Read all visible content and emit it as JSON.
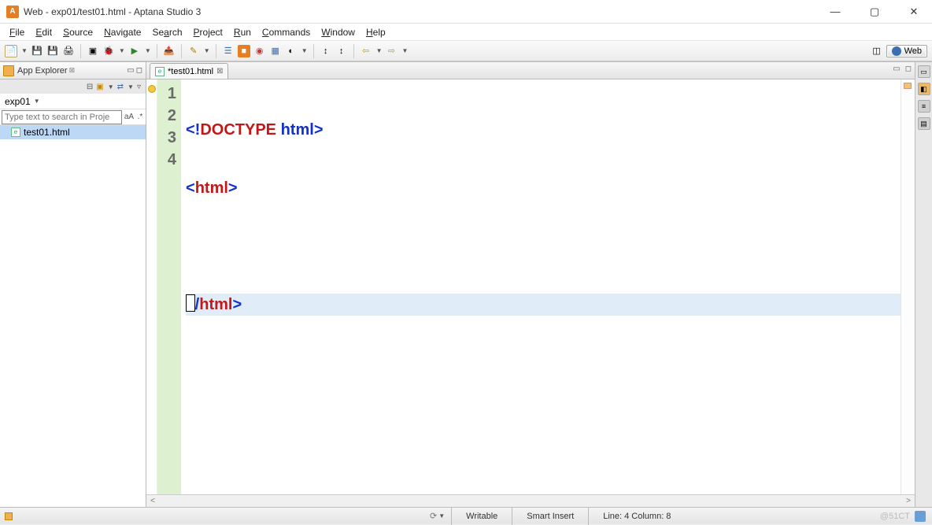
{
  "window": {
    "title": "Web - exp01/test01.html - Aptana Studio 3"
  },
  "menu": {
    "file": "File",
    "edit": "Edit",
    "source": "Source",
    "navigate": "Navigate",
    "search": "Search",
    "project": "Project",
    "run": "Run",
    "commands": "Commands",
    "window": "Window",
    "help": "Help"
  },
  "perspective": {
    "label": "Web"
  },
  "explorer": {
    "title": "App Explorer",
    "project": "exp01",
    "search_placeholder": "Type text to search in Proje",
    "aA": "aA",
    "star": ".*",
    "file": "test01.html"
  },
  "editor": {
    "tab_label": "*test01.html",
    "lines": {
      "l1": "1",
      "l2": "2",
      "l3": "3",
      "l4": "4"
    },
    "code": {
      "l1_open": "<!",
      "l1_doctype": "DOCTYPE",
      "l1_html": " html",
      "l1_close": ">",
      "l2_open": "<",
      "l2_tag": "html",
      "l2_close": ">",
      "l4_open": "</",
      "l4_tag": "html",
      "l4_close": ">"
    }
  },
  "status": {
    "writable": "Writable",
    "insert": "Smart Insert",
    "pos": "Line: 4 Column: 8",
    "watermark": "@51CT"
  }
}
